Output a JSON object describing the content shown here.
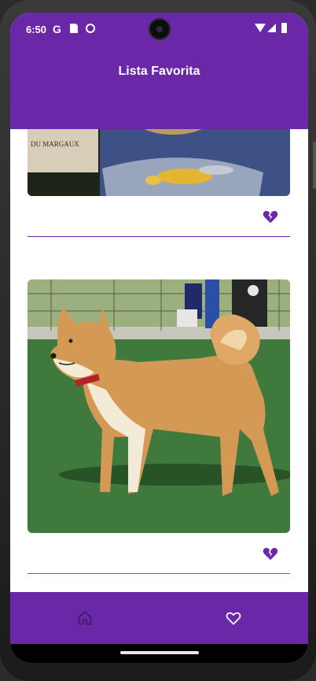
{
  "status_bar": {
    "time": "6:50",
    "google_glyph": "G",
    "icons": [
      "sd-card-icon",
      "notification-icon",
      "wifi-icon",
      "signal-icon",
      "battery-icon"
    ]
  },
  "app_bar": {
    "title": "Lista Favorita"
  },
  "favorites": [
    {
      "image": "dog-with-wine-bottle-photo",
      "label_in_photo": "DU MARGAUX",
      "action_icon": "broken-heart-icon"
    },
    {
      "image": "shiba-inu-photo",
      "action_icon": "broken-heart-icon"
    }
  ],
  "bottom_nav": {
    "items": [
      {
        "icon": "home-icon",
        "selected": false
      },
      {
        "icon": "heart-icon",
        "selected": true
      }
    ]
  },
  "colors": {
    "primary": "#6a27a8",
    "accent_icon": "#6a27a8",
    "background": "#ffffff"
  }
}
